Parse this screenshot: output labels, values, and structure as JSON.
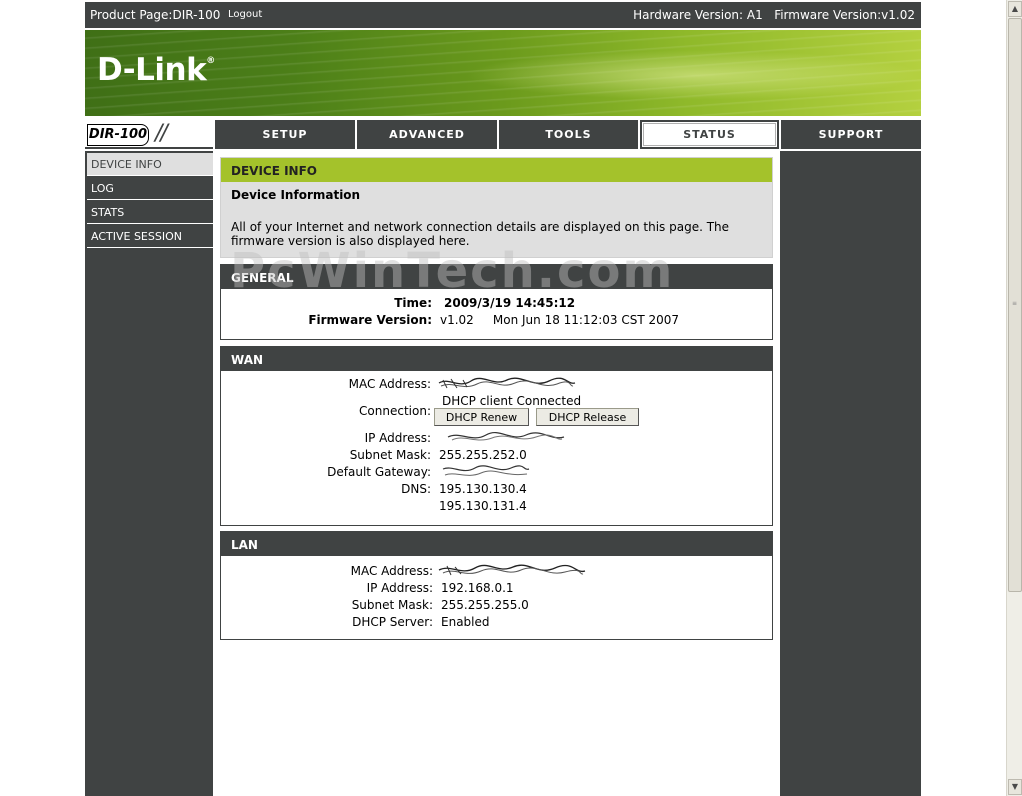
{
  "topbar": {
    "product_label": "Product Page:",
    "product_value": "DIR-100",
    "logout": "Logout",
    "hardware_version": "Hardware Version: A1",
    "firmware_version": "Firmware Version:v1.02"
  },
  "brand": {
    "logo_text": "D-Link",
    "registered": "®"
  },
  "model": "DIR-100",
  "nav": {
    "tabs": [
      {
        "label": "SETUP"
      },
      {
        "label": "ADVANCED"
      },
      {
        "label": "TOOLS"
      },
      {
        "label": "STATUS",
        "active": true
      },
      {
        "label": "SUPPORT"
      }
    ]
  },
  "sidebar": {
    "items": [
      {
        "label": "DEVICE INFO",
        "active": true
      },
      {
        "label": "LOG"
      },
      {
        "label": "STATS"
      },
      {
        "label": "ACTIVE SESSION"
      }
    ]
  },
  "device_info": {
    "header": "DEVICE INFO",
    "subtitle": "Device Information",
    "description": "All of your Internet and network connection details are displayed on this page. The firmware version is also displayed here."
  },
  "watermark": "PcWinTech.com",
  "general": {
    "header": "GENERAL",
    "time_label": "Time:",
    "time_value": "2009/3/19 14:45:12",
    "fw_label": "Firmware Version:",
    "fw_value": "v1.02     Mon Jun 18 11:12:03 CST 2007"
  },
  "wan": {
    "header": "WAN",
    "mac_label": "MAC Address:",
    "connection_label": "Connection:",
    "connection_value": "DHCP client Connected",
    "renew_button": "DHCP Renew",
    "release_button": "DHCP Release",
    "ip_label": "IP Address:",
    "subnet_label": "Subnet Mask:",
    "subnet_value": "255.255.252.0",
    "gateway_label": "Default Gateway:",
    "dns_label": "DNS:",
    "dns1": "195.130.130.4",
    "dns2": "195.130.131.4"
  },
  "lan": {
    "header": "LAN",
    "mac_label": "MAC Address:",
    "ip_label": "IP Address:",
    "ip_value": "192.168.0.1",
    "subnet_label": "Subnet Mask:",
    "subnet_value": "255.255.255.0",
    "dhcp_label": "DHCP Server:",
    "dhcp_value": "Enabled"
  },
  "colors": {
    "dark_gray": "#404343",
    "accent_green": "#a4c22b",
    "info_bg": "#dfdfdf"
  }
}
